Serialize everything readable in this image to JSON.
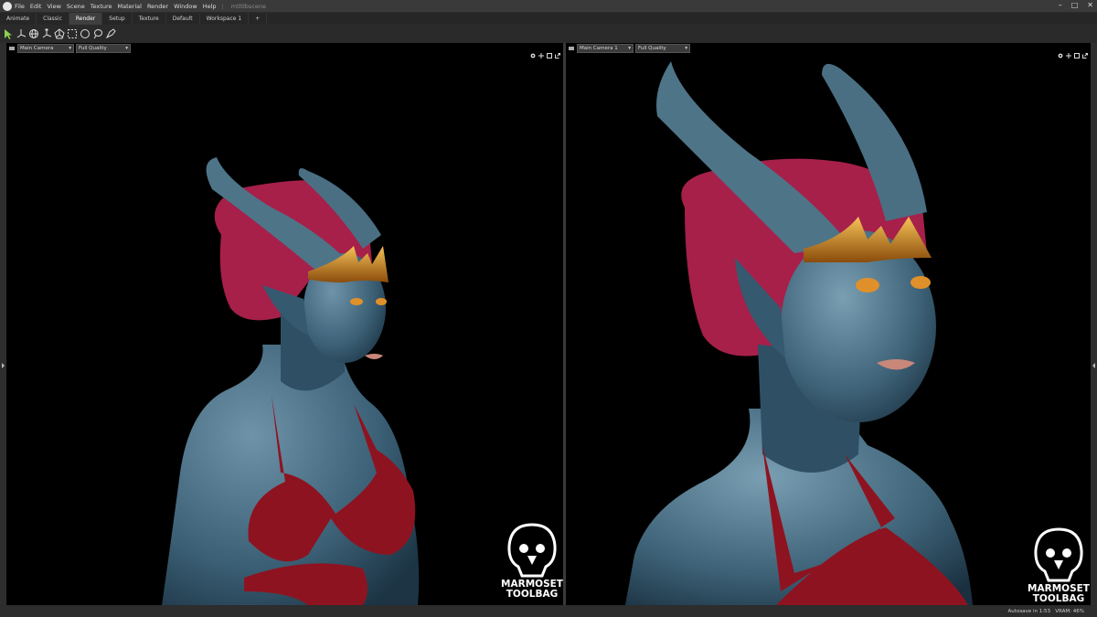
{
  "menubar": {
    "items": [
      "File",
      "Edit",
      "View",
      "Scene",
      "Texture",
      "Material",
      "Render",
      "Window",
      "Help"
    ],
    "filename": "mtltlbscene"
  },
  "tabs": [
    "Animate",
    "Classic",
    "Render",
    "Setup",
    "Texture",
    "Default",
    "Workspace 1",
    "+"
  ],
  "active_tab": "Render",
  "viewports": [
    {
      "camera": "Main Camera",
      "quality": "Full Quality"
    },
    {
      "camera": "Main Camera 1",
      "quality": "Full Quality"
    }
  ],
  "branding": {
    "line1": "MARMOSET",
    "line2": "TOOLBAG"
  },
  "status": "Autosave in 1:53   VRAM: 46%",
  "colors": {
    "skin": "#3d6278",
    "hair": "#a6204a",
    "suit": "#8e1320",
    "crown": "#d08a1c",
    "accent": "#8fd14f"
  }
}
